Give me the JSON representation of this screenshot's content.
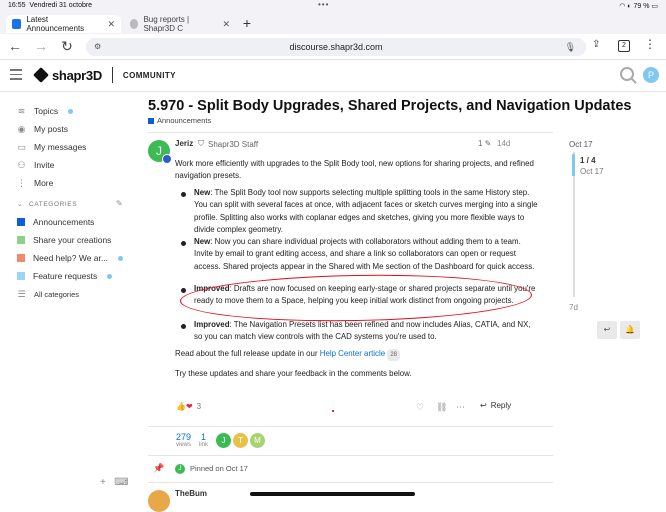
{
  "status": {
    "time": "16:55",
    "date": "Vendredi 31 octobre",
    "battery": "79 %",
    "dots": "•••"
  },
  "tabs": [
    {
      "label": "Latest Announcements",
      "active": true,
      "close": "✕"
    },
    {
      "label": "Bug reports | Shapr3D C",
      "active": false,
      "close": "✕"
    }
  ],
  "toolbar": {
    "url": "discourse.shapr3d.com",
    "tab_count": "2",
    "back": "←",
    "forward": "→",
    "reload": "↻",
    "new_tab": "+"
  },
  "header": {
    "logo_text": "shapr3D",
    "community_label": "COMMUNITY",
    "user_initial": "P"
  },
  "sidebar": {
    "items": [
      {
        "label": "Topics",
        "icon": "layers-icon",
        "glyph": "≋",
        "dot": true
      },
      {
        "label": "My posts",
        "icon": "user-icon",
        "glyph": "◉",
        "dot": false
      },
      {
        "label": "My messages",
        "icon": "inbox-icon",
        "glyph": "▭",
        "dot": false
      },
      {
        "label": "Invite",
        "icon": "add-user-icon",
        "glyph": "⚇",
        "dot": false
      },
      {
        "label": "More",
        "icon": "more-icon",
        "glyph": "⋮",
        "dot": false
      }
    ],
    "categories_header": "CATEGORIES",
    "categories": [
      {
        "label": "Announcements",
        "color": "#0b5ed7",
        "dot": false
      },
      {
        "label": "Share your creations",
        "color": "#8fcf8a",
        "dot": false
      },
      {
        "label": "Need help? We ar...",
        "color": "#f08a6a",
        "dot": true
      },
      {
        "label": "Feature requests",
        "color": "#9dd4f2",
        "dot": true
      },
      {
        "label": "All categories",
        "color": "",
        "dot": false
      }
    ]
  },
  "topic": {
    "title": "5.970 - Split Body Upgrades, Shared Projects, and Navigation Updates",
    "category": "Announcements"
  },
  "post": {
    "author": "Jeriz",
    "author_initial": "J",
    "role": "Shapr3D Staff",
    "edit_count": "1",
    "date": "14d",
    "intro": "Work more efficiently with upgrades to the Split Body tool, new options for sharing projects, and refined navigation presets.",
    "bullets": [
      {
        "label": "New",
        "text": ": The Split Body tool now supports selecting multiple splitting tools in the same History step. You can split with several faces at once, with adjacent faces or sketch curves merging into a single profile. Splitting also works with coplanar edges and sketches, giving you more flexible ways to divide complex geometry."
      },
      {
        "label": "New",
        "text": ": Now you can share individual projects with collaborators without adding them to a team. Invite by email to grant editing access, and share a link so collaborators can open or request access. Shared projects appear in the Shared with Me section of the Dashboard for quick access."
      },
      {
        "label": "Improved",
        "text": ": Drafts are now focused on keeping early-stage or shared projects separate until you're ready to move them to a Space, helping you keep initial work distinct from ongoing projects."
      },
      {
        "label": "Improved",
        "text": ": The Navigation Presets list has been refined and now includes Alias, CATIA, and NX, so you can match view controls with the CAD systems you're used to."
      }
    ],
    "read_more_prefix": "Read about the full release update in our ",
    "read_more_link": "Help Center article",
    "read_more_count": "28",
    "closing": "Try these updates and share your feedback in the comments below.",
    "reaction_count": "3",
    "reply_label": "Reply"
  },
  "stats": {
    "views": "279",
    "views_label": "views",
    "links": "1",
    "links_label": "link"
  },
  "participants": [
    {
      "initial": "J",
      "color": "#3cba54"
    },
    {
      "initial": "T",
      "color": "#e8c14a"
    },
    {
      "initial": "M",
      "color": "#a8d46f"
    }
  ],
  "pinned": {
    "text": "Pinned on Oct 17",
    "initial": "J"
  },
  "next_post": {
    "author": "TheBum"
  },
  "timeline": {
    "top_date": "Oct 17",
    "position": "1 / 4",
    "position_date": "Oct 17",
    "bottom_label": "7d"
  },
  "colors": {
    "accent": "#0b6fcf",
    "annotation": "#e00d17",
    "timeline": "#7fc8f0"
  }
}
